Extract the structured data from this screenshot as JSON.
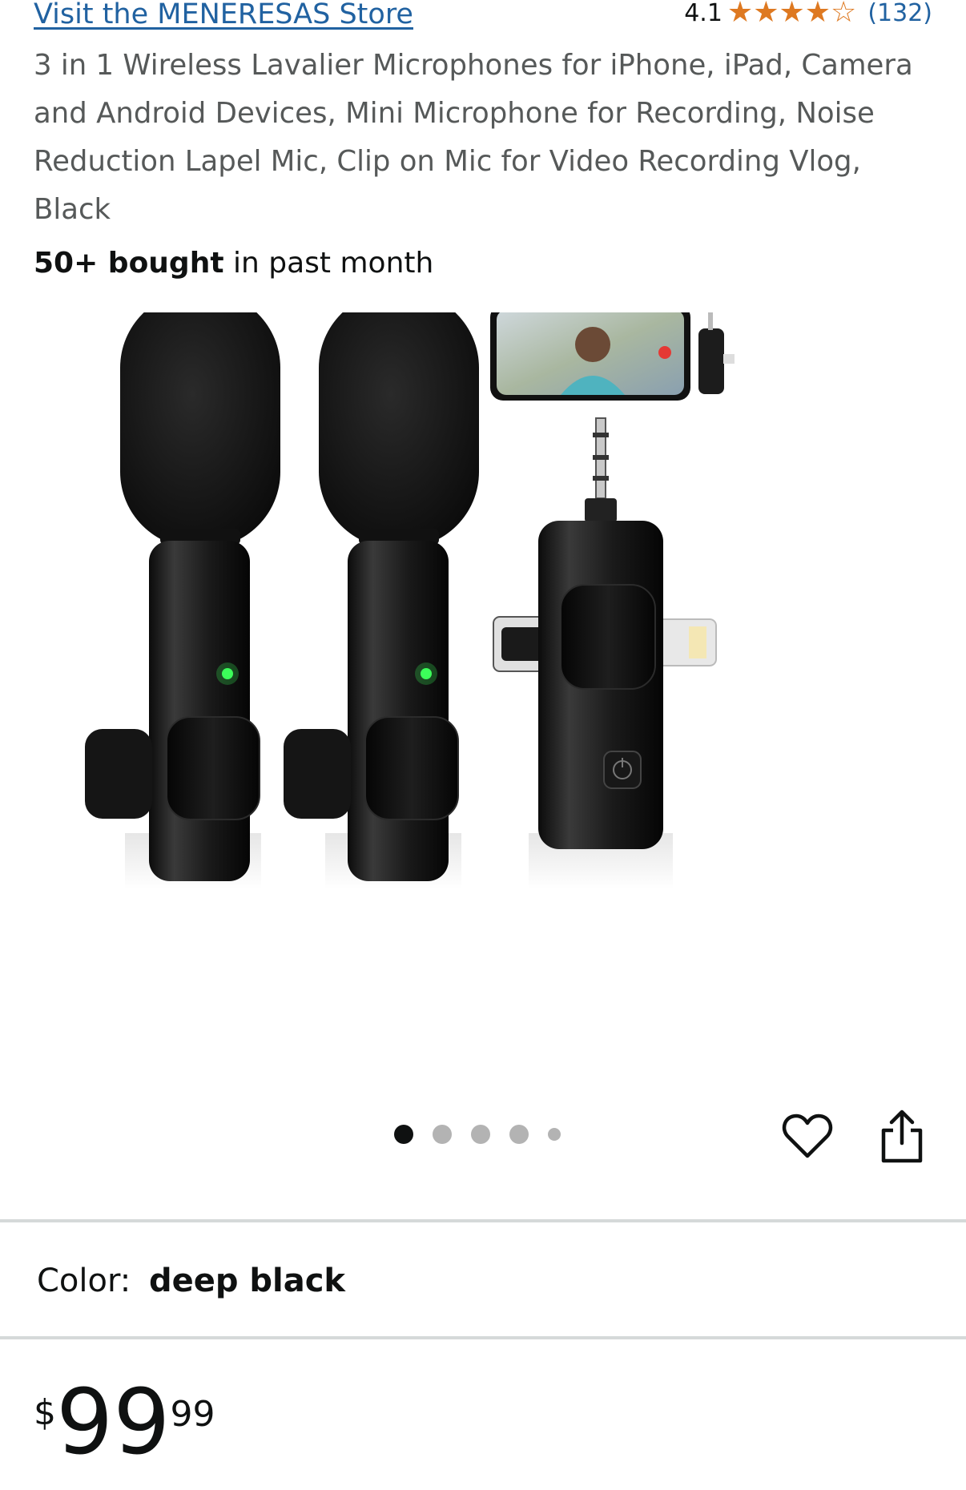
{
  "store": {
    "link_text": "Visit the MENERESAS Store"
  },
  "rating": {
    "value": "4.1",
    "count": "(132)",
    "stars_filled": 4,
    "stars_total": 5
  },
  "product": {
    "title": "3 in 1 Wireless Lavalier Microphones for iPhone, iPad, Camera and Android Devices, Mini Microphone for Recording, Noise Reduction Lapel Mic, Clip on Mic for Video Recording Vlog, Black",
    "bought_bold": "50+ bought",
    "bought_rest": " in past month"
  },
  "gallery": {
    "image_count": 5,
    "active_index": 0
  },
  "icons": {
    "wishlist": "heart-icon",
    "share": "share-icon",
    "star": "star-icon"
  },
  "variant": {
    "label": "Color:",
    "value": "deep black"
  },
  "price": {
    "symbol": "$",
    "whole": "99",
    "fraction": "99"
  },
  "colors": {
    "link": "#2162a1",
    "star": "#de7921",
    "text": "#0f1111",
    "muted": "#565959",
    "divider": "#d5d9d9"
  }
}
